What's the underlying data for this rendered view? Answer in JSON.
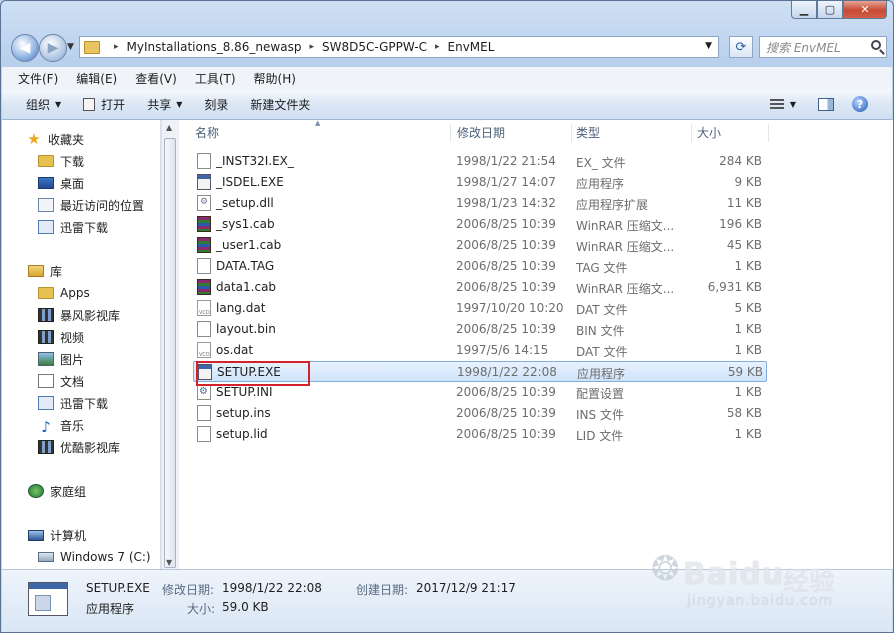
{
  "window": {
    "controls": {
      "minimize": "▁",
      "maximize": "▢",
      "close": "✕"
    }
  },
  "address_bar": {
    "breadcrumbs": [
      "MyInstallations_8.86_newasp",
      "SW8D5C-GPPW-C",
      "EnvMEL"
    ],
    "separator": "▸",
    "search_placeholder": "搜索 EnvMEL"
  },
  "menu": [
    "文件(F)",
    "编辑(E)",
    "查看(V)",
    "工具(T)",
    "帮助(H)"
  ],
  "toolbar": {
    "organize": "组织",
    "open": "打开",
    "share": "共享",
    "burn": "刻录",
    "new_folder": "新建文件夹",
    "help": "?"
  },
  "nav_pane": {
    "favorites": {
      "label": "收藏夹",
      "items": [
        "下载",
        "桌面",
        "最近访问的位置",
        "迅雷下载"
      ]
    },
    "libraries": {
      "label": "库",
      "items": [
        "Apps",
        "暴风影视库",
        "视频",
        "图片",
        "文档",
        "迅雷下载",
        "音乐",
        "优酷影视库"
      ]
    },
    "homegroup": "家庭组",
    "computer": {
      "label": "计算机",
      "items": [
        "Windows 7 (C:)"
      ]
    }
  },
  "columns": {
    "name": "名称",
    "date": "修改日期",
    "type": "类型",
    "size": "大小"
  },
  "files": [
    {
      "name": "_INST32I.EX_",
      "date": "1998/1/22 21:54",
      "type": "EX_ 文件",
      "size": "284 KB",
      "icon": "file"
    },
    {
      "name": "_ISDEL.EXE",
      "date": "1998/1/27 14:07",
      "type": "应用程序",
      "size": "9 KB",
      "icon": "exe"
    },
    {
      "name": "_setup.dll",
      "date": "1998/1/23 14:32",
      "type": "应用程序扩展",
      "size": "11 KB",
      "icon": "dll"
    },
    {
      "name": "_sys1.cab",
      "date": "2006/8/25 10:39",
      "type": "WinRAR 压缩文...",
      "size": "196 KB",
      "icon": "rar"
    },
    {
      "name": "_user1.cab",
      "date": "2006/8/25 10:39",
      "type": "WinRAR 压缩文...",
      "size": "45 KB",
      "icon": "rar"
    },
    {
      "name": "DATA.TAG",
      "date": "2006/8/25 10:39",
      "type": "TAG 文件",
      "size": "1 KB",
      "icon": "file"
    },
    {
      "name": "data1.cab",
      "date": "2006/8/25 10:39",
      "type": "WinRAR 压缩文...",
      "size": "6,931 KB",
      "icon": "rar"
    },
    {
      "name": "lang.dat",
      "date": "1997/10/20 10:20",
      "type": "DAT 文件",
      "size": "5 KB",
      "icon": "vcd"
    },
    {
      "name": "layout.bin",
      "date": "2006/8/25 10:39",
      "type": "BIN 文件",
      "size": "1 KB",
      "icon": "file"
    },
    {
      "name": "os.dat",
      "date": "1997/5/6 14:15",
      "type": "DAT 文件",
      "size": "1 KB",
      "icon": "vcd"
    },
    {
      "name": "SETUP.EXE",
      "date": "1998/1/22 22:08",
      "type": "应用程序",
      "size": "59 KB",
      "icon": "exe",
      "selected": true
    },
    {
      "name": "SETUP.INI",
      "date": "2006/8/25 10:39",
      "type": "配置设置",
      "size": "1 KB",
      "icon": "ini"
    },
    {
      "name": "setup.ins",
      "date": "2006/8/25 10:39",
      "type": "INS 文件",
      "size": "58 KB",
      "icon": "file"
    },
    {
      "name": "setup.lid",
      "date": "2006/8/25 10:39",
      "type": "LID 文件",
      "size": "1 KB",
      "icon": "file"
    }
  ],
  "details": {
    "name": "SETUP.EXE",
    "type": "应用程序",
    "modified_label": "修改日期:",
    "modified": "1998/1/22 22:08",
    "created_label": "创建日期:",
    "created": "2017/12/9 21:17",
    "size_label": "大小:",
    "size": "59.0 KB"
  },
  "watermark": {
    "brand": "Baidu",
    "cn": "经验",
    "url": "jingyan.baidu.com"
  },
  "colors": {
    "selection_outline": "#d2222a",
    "selection_fill": "#cfe4fb"
  }
}
